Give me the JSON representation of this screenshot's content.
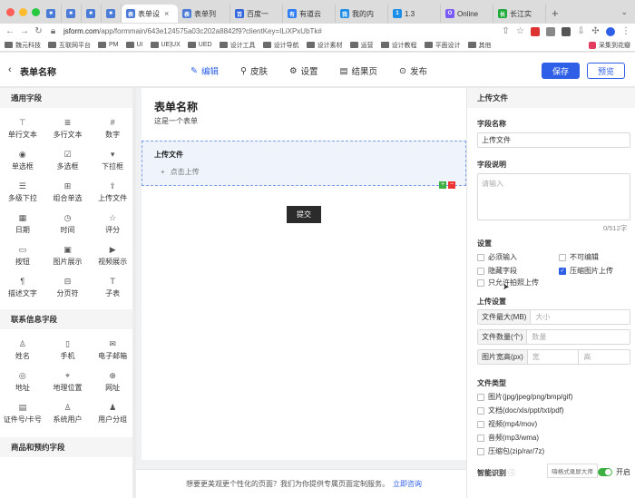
{
  "browser": {
    "tabs": [
      {
        "label": "",
        "fav": "#4a7bd6",
        "glyph": "■"
      },
      {
        "label": "",
        "fav": "#4a7bd6",
        "glyph": "■"
      },
      {
        "label": "",
        "fav": "#4a7bd6",
        "glyph": "■"
      },
      {
        "label": "",
        "fav": "#4a7bd6",
        "glyph": "■"
      },
      {
        "label": "表单设",
        "fav": "#4a7bd6",
        "glyph": "表",
        "active": true
      },
      {
        "label": "表单列",
        "fav": "#4a7bd6",
        "glyph": "表"
      },
      {
        "label": "百度一",
        "fav": "#3366dd",
        "glyph": "百"
      },
      {
        "label": "有道云",
        "fav": "#2e7cf6",
        "glyph": "有"
      },
      {
        "label": "我的内",
        "fav": "#1d8fe8",
        "glyph": "我"
      },
      {
        "label": "1.3",
        "fav": "#1d8fe8",
        "glyph": "1"
      },
      {
        "label": "Online",
        "fav": "#7a5af5",
        "glyph": "O"
      },
      {
        "label": "长江实",
        "fav": "#1faa3b",
        "glyph": "长"
      }
    ],
    "new_tab": "+",
    "url_host": "jsform.com",
    "url_path": "/app/formmain/643e124575a03c202a8842f9?clientKey=ILiXPxUbTk#",
    "bookmarks": [
      "魏元科技",
      "互联网平台",
      "PM",
      "UI",
      "UE|UX",
      "UED",
      "设计工具",
      "设计导航",
      "设计素材",
      "运营",
      "设计教程",
      "平面设计",
      "其他"
    ],
    "bookmark_extra": "采集到花瓣"
  },
  "header": {
    "back": "‹",
    "title": "表单名称",
    "nav": [
      {
        "icon": "✎",
        "label": "编辑",
        "active": true
      },
      {
        "icon": "⚲",
        "label": "皮肤"
      },
      {
        "icon": "⚙",
        "label": "设置"
      },
      {
        "icon": "▤",
        "label": "结果页"
      },
      {
        "icon": "⊙",
        "label": "发布"
      }
    ],
    "save": "保存",
    "preview": "预览"
  },
  "palette": {
    "common_title": "通用字段",
    "common": [
      {
        "icon": "⊤",
        "label": "单行文本"
      },
      {
        "icon": "≣",
        "label": "多行文本"
      },
      {
        "icon": "#",
        "label": "数字"
      },
      {
        "icon": "◉",
        "label": "单选框"
      },
      {
        "icon": "☑",
        "label": "多选框"
      },
      {
        "icon": "▾",
        "label": "下拉框"
      },
      {
        "icon": "☰",
        "label": "多级下拉"
      },
      {
        "icon": "⊞",
        "label": "组合单选"
      },
      {
        "icon": "⇪",
        "label": "上传文件"
      },
      {
        "icon": "▦",
        "label": "日期"
      },
      {
        "icon": "◷",
        "label": "时间"
      },
      {
        "icon": "☆",
        "label": "评分"
      },
      {
        "icon": "▭",
        "label": "按钮"
      },
      {
        "icon": "▣",
        "label": "图片展示"
      },
      {
        "icon": "▶",
        "label": "视频展示"
      },
      {
        "icon": "¶",
        "label": "描述文字"
      },
      {
        "icon": "⊟",
        "label": "分页符"
      },
      {
        "icon": "T",
        "label": "子表"
      }
    ],
    "contact_title": "联系信息字段",
    "contact": [
      {
        "icon": "♙",
        "label": "姓名"
      },
      {
        "icon": "▯",
        "label": "手机"
      },
      {
        "icon": "✉",
        "label": "电子邮箱"
      },
      {
        "icon": "◎",
        "label": "地址"
      },
      {
        "icon": "⌖",
        "label": "地理位置"
      },
      {
        "icon": "⊕",
        "label": "网址"
      },
      {
        "icon": "▤",
        "label": "证件号/卡号"
      },
      {
        "icon": "♙",
        "label": "系统用户"
      },
      {
        "icon": "♟",
        "label": "用户分组"
      }
    ],
    "product_title": "商品和预约字段"
  },
  "canvas": {
    "title": "表单名称",
    "desc": "这是一个表单",
    "field_label": "上传文件",
    "upload_plus": "+",
    "upload_text": "点击上传",
    "add": "+",
    "del": "−",
    "submit": "提交",
    "footer_text": "想要更美观更个性化的页面？我们为你提供专属页面定制服务。",
    "footer_link": "立即咨询"
  },
  "props": {
    "head": "上传文件",
    "name_label": "字段名称",
    "name_value": "上传文件",
    "desc_label": "字段说明",
    "desc_placeholder": "请输入",
    "counter": "0/512字",
    "settings_label": "设置",
    "opt_required": "必须输入",
    "opt_readonly": "不可编辑",
    "opt_hidden": "隐藏字段",
    "opt_compress": "压缩图片上传",
    "opt_camera": "只允许拍照上传",
    "upload_settings_label": "上传设置",
    "max_size_tag": "文件最大(MB)",
    "max_size_ph": "大小",
    "count_tag": "文件数量(个)",
    "count_ph": "数量",
    "img_size_tag": "图片宽高(px)",
    "width_ph": "宽",
    "height_ph": "高",
    "types_label": "文件类型",
    "types": [
      "图片(jpg/jpeg/png/bmp/gif)",
      "文档(doc/xls/ppt/txt/pdf)",
      "视频(mp4/mov)",
      "音频(mp3/wma)",
      "压缩包(zip/rar/7z)"
    ],
    "smart_label": "智能识别",
    "toggle_label": "开启",
    "watermark": "嗨格式录屏大师"
  }
}
